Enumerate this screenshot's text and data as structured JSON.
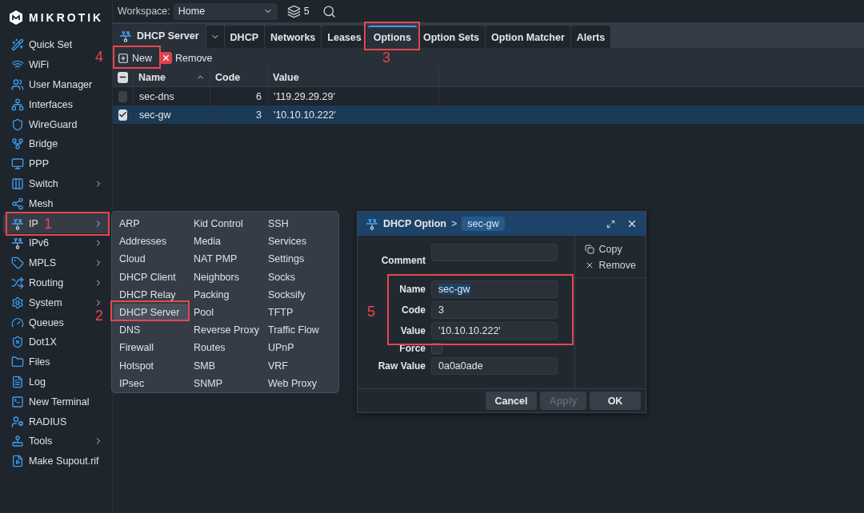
{
  "brand": {
    "name": "MIKROTIK"
  },
  "sidebar": {
    "items": [
      {
        "label": "Quick Set",
        "submenu": false,
        "selected": false
      },
      {
        "label": "WiFi",
        "submenu": false,
        "selected": false
      },
      {
        "label": "User Manager",
        "submenu": false,
        "selected": false
      },
      {
        "label": "Interfaces",
        "submenu": false,
        "selected": false
      },
      {
        "label": "WireGuard",
        "submenu": false,
        "selected": false
      },
      {
        "label": "Bridge",
        "submenu": false,
        "selected": false
      },
      {
        "label": "PPP",
        "submenu": false,
        "selected": false
      },
      {
        "label": "Switch",
        "submenu": true,
        "selected": false
      },
      {
        "label": "Mesh",
        "submenu": false,
        "selected": false
      },
      {
        "label": "IP",
        "submenu": true,
        "selected": true
      },
      {
        "label": "IPv6",
        "submenu": true,
        "selected": false
      },
      {
        "label": "MPLS",
        "submenu": true,
        "selected": false
      },
      {
        "label": "Routing",
        "submenu": true,
        "selected": false
      },
      {
        "label": "System",
        "submenu": true,
        "selected": false
      },
      {
        "label": "Queues",
        "submenu": false,
        "selected": false
      },
      {
        "label": "Dot1X",
        "submenu": false,
        "selected": false
      },
      {
        "label": "Files",
        "submenu": false,
        "selected": false
      },
      {
        "label": "Log",
        "submenu": false,
        "selected": false
      },
      {
        "label": "New Terminal",
        "submenu": false,
        "selected": false
      },
      {
        "label": "RADIUS",
        "submenu": false,
        "selected": false
      },
      {
        "label": "Tools",
        "submenu": true,
        "selected": false
      },
      {
        "label": "Make Supout.rif",
        "submenu": false,
        "selected": false
      }
    ]
  },
  "topbar": {
    "workspace_label": "Workspace:",
    "workspace_value": "Home",
    "windows_count": "5"
  },
  "window": {
    "title": "DHCP Server",
    "tabs": [
      {
        "label": "DHCP",
        "selected": false
      },
      {
        "label": "Networks",
        "selected": false
      },
      {
        "label": "Leases",
        "selected": false
      },
      {
        "label": "Options",
        "selected": true
      },
      {
        "label": "Option Sets",
        "selected": false
      },
      {
        "label": "Option Matcher",
        "selected": false
      },
      {
        "label": "Alerts",
        "selected": false
      }
    ],
    "toolbar": [
      {
        "label": "New",
        "kind": "new"
      },
      {
        "label": "Remove",
        "kind": "remove"
      }
    ]
  },
  "table": {
    "header_indeterminate": true,
    "columns": [
      {
        "label": "Name",
        "sorted": true,
        "kind": "text"
      },
      {
        "label": "Code",
        "sorted": false,
        "kind": "number"
      },
      {
        "label": "Value",
        "sorted": false,
        "kind": "text"
      }
    ],
    "rows": [
      {
        "cells": [
          "sec-dns",
          "6",
          "'119.29.29.29'"
        ],
        "selected": false
      },
      {
        "cells": [
          "sec-gw",
          "3",
          "'10.10.10.222'"
        ],
        "selected": true
      }
    ]
  },
  "ip_menu": {
    "items": [
      {
        "label": "ARP",
        "selected": false
      },
      {
        "label": "Addresses",
        "selected": false
      },
      {
        "label": "Cloud",
        "selected": false
      },
      {
        "label": "DHCP Client",
        "selected": false
      },
      {
        "label": "DHCP Relay",
        "selected": false
      },
      {
        "label": "DHCP Server",
        "selected": true
      },
      {
        "label": "DNS",
        "selected": false
      },
      {
        "label": "Firewall",
        "selected": false
      },
      {
        "label": "Hotspot",
        "selected": false
      },
      {
        "label": "IPsec",
        "selected": false
      },
      {
        "label": "Kid Control",
        "selected": false
      },
      {
        "label": "Media",
        "selected": false
      },
      {
        "label": "NAT PMP",
        "selected": false
      },
      {
        "label": "Neighbors",
        "selected": false
      },
      {
        "label": "Packing",
        "selected": false
      },
      {
        "label": "Pool",
        "selected": false
      },
      {
        "label": "Reverse Proxy",
        "selected": false
      },
      {
        "label": "Routes",
        "selected": false
      },
      {
        "label": "SMB",
        "selected": false
      },
      {
        "label": "SNMP",
        "selected": false
      },
      {
        "label": "SSH",
        "selected": false
      },
      {
        "label": "Services",
        "selected": false
      },
      {
        "label": "Settings",
        "selected": false
      },
      {
        "label": "Socks",
        "selected": false
      },
      {
        "label": "Socksify",
        "selected": false
      },
      {
        "label": "TFTP",
        "selected": false
      },
      {
        "label": "Traffic Flow",
        "selected": false
      },
      {
        "label": "UPnP",
        "selected": false
      },
      {
        "label": "VRF",
        "selected": false
      },
      {
        "label": "Web Proxy",
        "selected": false
      }
    ]
  },
  "dialog": {
    "title": "DHCP Option",
    "separator": ">",
    "record": "sec-gw",
    "fields": [
      {
        "kind": "input",
        "label": "Comment"
      },
      {
        "kind": "input",
        "label": "Name",
        "value": "sec-gw",
        "text_selected": true
      },
      {
        "kind": "input",
        "label": "Code",
        "value": "3"
      },
      {
        "kind": "input",
        "label": "Value",
        "value": "'10.10.10.222'"
      },
      {
        "kind": "checkbox",
        "label": "Force",
        "checked": false
      },
      {
        "kind": "input",
        "label": "Raw Value",
        "value": "0a0a0ade"
      }
    ],
    "actions": [
      {
        "label": "Copy",
        "kind": "copy"
      },
      {
        "label": "Remove",
        "kind": "remove"
      }
    ],
    "buttons": [
      {
        "label": "Cancel",
        "disabled": false
      },
      {
        "label": "Apply",
        "disabled": true
      },
      {
        "label": "OK",
        "disabled": false
      }
    ]
  },
  "annotations": [
    {
      "label": "1"
    },
    {
      "label": "2"
    },
    {
      "label": "3"
    },
    {
      "label": "4"
    },
    {
      "label": "5"
    }
  ]
}
